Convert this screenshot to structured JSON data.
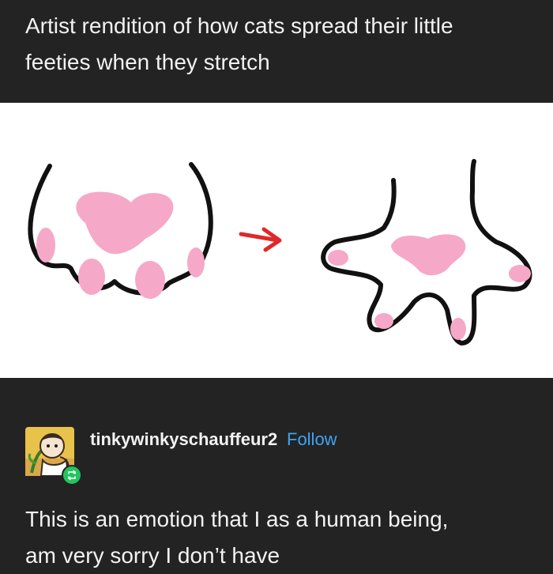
{
  "post": {
    "caption_line1": "Artist rendition of how cats spread their little",
    "caption_line2": "feeties when they stretch"
  },
  "image": {
    "before_paw_icon": "closed-cat-paw",
    "arrow_icon": "red-arrow-right",
    "after_paw_icon": "spread-cat-paw",
    "pad_color": "#f6a8c8",
    "arrow_color": "#e0282a",
    "outline_color": "#111111"
  },
  "reblog": {
    "username": "tinkywinkyschauffeur2",
    "follow_label": "Follow",
    "follow_color": "#3fa3f5",
    "badge_color": "#22c55e",
    "comment_line1": "This is an emotion that I as a human being,",
    "comment_line2": "am very sorry I don’t have"
  }
}
